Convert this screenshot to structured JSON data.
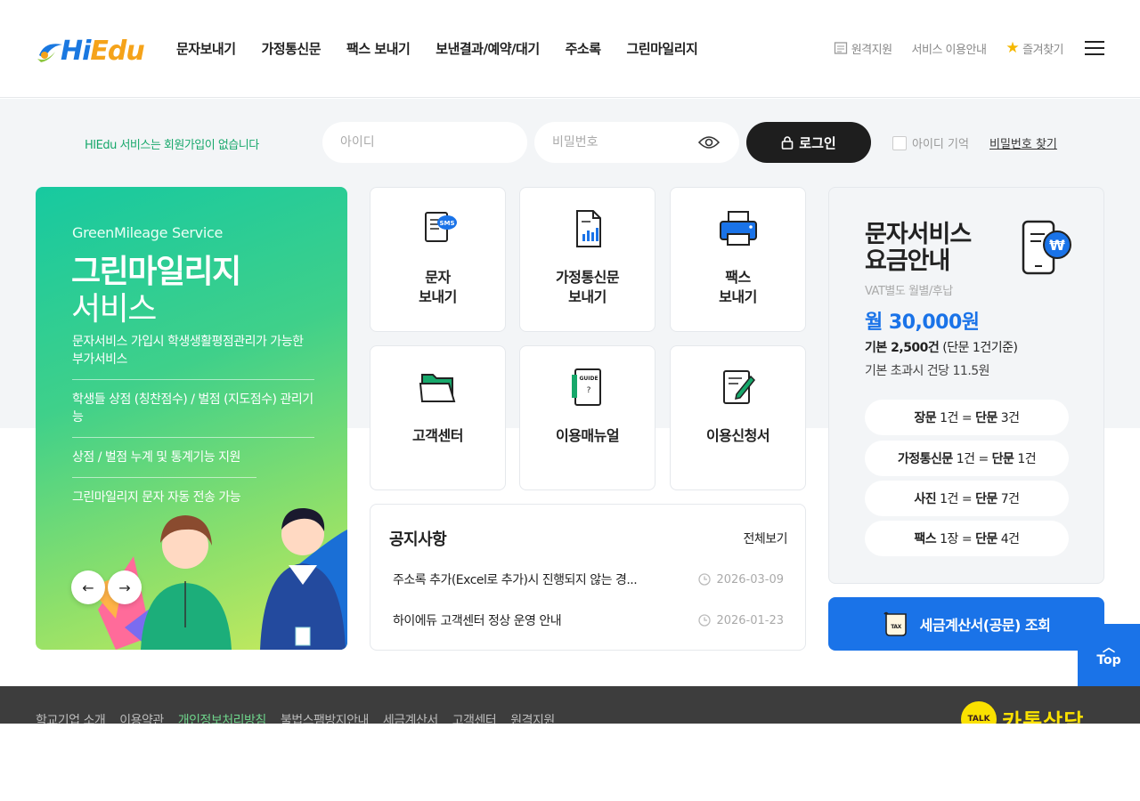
{
  "header": {
    "logo_hi": "Hi",
    "logo_edu": "Edu",
    "nav": [
      "문자보내기",
      "가정통신문",
      "팩스 보내기",
      "보낸결과/예약/대기",
      "주소록",
      "그린마일리지"
    ],
    "util": {
      "remote": "원격지원",
      "guide": "서비스 이용안내",
      "favorite": "즐겨찾기"
    }
  },
  "login": {
    "message": "HIEdu 서비스는 회원가입이 없습니다",
    "id_placeholder": "아이디",
    "pw_placeholder": "비밀번호",
    "button": "로그인",
    "remember": "아이디 기억",
    "find_pw": "비밀번호 찾기"
  },
  "banner": {
    "subtitle": "GreenMileage Service",
    "title": "그린마일리지",
    "title2": "서비스",
    "items": [
      "문자서비스 가입시 학생생활평점관리가 가능한 부가서비스",
      "학생들 상점 (칭찬점수) / 벌점 (지도점수) 관리기능",
      "상점 / 벌점 누계 및 통계기능 지원",
      "그린마일리지 문자 자동 전송 가능"
    ]
  },
  "tiles": [
    {
      "line1": "문자",
      "line2": "보내기",
      "icon": "sms-document-icon"
    },
    {
      "line1": "가정통신문",
      "line2": "보내기",
      "icon": "newsletter-chart-icon"
    },
    {
      "line1": "팩스",
      "line2": "보내기",
      "icon": "fax-printer-icon"
    },
    {
      "line1": "고객센터",
      "line2": "",
      "icon": "folder-icon"
    },
    {
      "line1": "이용매뉴얼",
      "line2": "",
      "icon": "guide-book-icon"
    },
    {
      "line1": "이용신청서",
      "line2": "",
      "icon": "application-form-icon"
    }
  ],
  "notice": {
    "title": "공지사항",
    "more": "전체보기",
    "items": [
      {
        "title": "주소록 추가(Excel로 추가)시 진행되지 않는 경...",
        "date": "2026-03-09"
      },
      {
        "title": "하이에듀 고객센터 정상 운영 안내",
        "date": "2026-01-23"
      }
    ]
  },
  "pricing": {
    "title1": "문자서비스",
    "title2": "요금안내",
    "vat": "VAT별도 월별/후납",
    "amount": "월 30,000원",
    "base_bold": "기본 2,500건",
    "base_rest": " (단문 1건기준)",
    "excess": "기본 초과시 건당 11.5원",
    "rates": [
      {
        "a": "장문",
        "b": " 1건 = ",
        "c": "단문",
        "d": " 3건"
      },
      {
        "a": "가정통신문",
        "b": " 1건 = ",
        "c": "단문",
        "d": " 1건"
      },
      {
        "a": "사진",
        "b": " 1건 = ",
        "c": "단문",
        "d": " 7건"
      },
      {
        "a": "팩스",
        "b": " 1장 = ",
        "c": "단문",
        "d": " 4건"
      }
    ]
  },
  "tax_button": "세금계산서(공문) 조회",
  "top_button": "Top",
  "footer": {
    "links": [
      "학교기업 소개",
      "이용약관",
      "개인정보처리방침",
      "불법스팸방지안내",
      "세금계산서",
      "고객센터",
      "원격지원"
    ],
    "highlight_index": 2,
    "kakao_icon_label": "TALK",
    "kakao": "카톡상담"
  },
  "colors": {
    "primary": "#1a73e8",
    "green": "#17a86b",
    "dark": "#1e1e1e"
  }
}
